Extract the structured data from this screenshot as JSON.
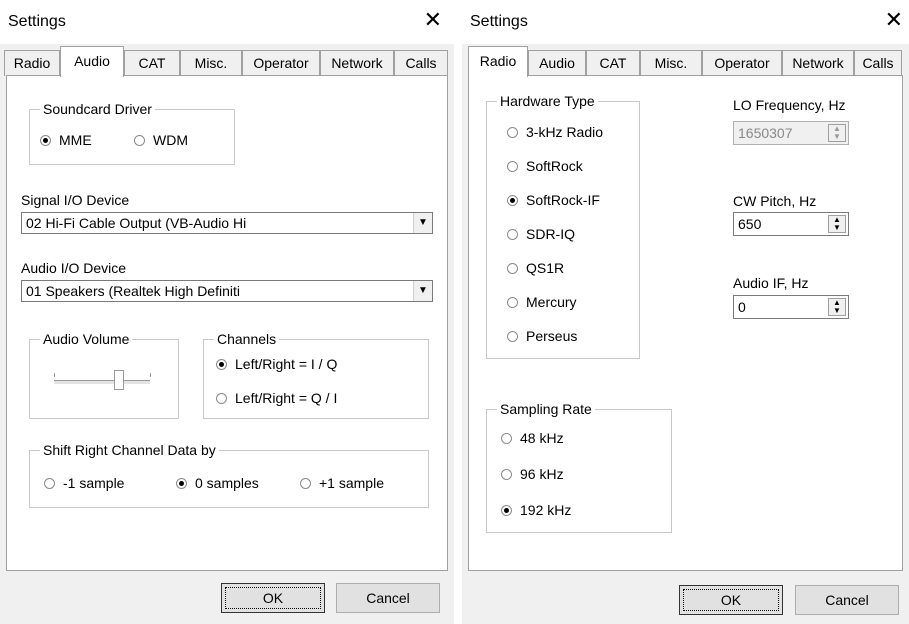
{
  "left": {
    "title": "Settings",
    "close": "✕",
    "tabs": [
      "Radio",
      "Audio",
      "CAT",
      "Misc.",
      "Operator",
      "Network",
      "Calls"
    ],
    "active_tab": "Audio",
    "soundcard_driver": {
      "legend": "Soundcard Driver",
      "options": [
        "MME",
        "WDM"
      ],
      "selected": "MME"
    },
    "signal_io": {
      "label": "Signal I/O Device",
      "value": "02  Hi-Fi Cable Output (VB-Audio Hi"
    },
    "audio_io": {
      "label": "Audio I/O Device",
      "value": "01  Speakers (Realtek High Definiti"
    },
    "audio_volume": {
      "legend": "Audio Volume",
      "level": 0.7
    },
    "channels": {
      "legend": "Channels",
      "options": [
        "Left/Right = I / Q",
        "Left/Right = Q / I"
      ],
      "selected": "Left/Right = I / Q"
    },
    "shift": {
      "legend": "Shift Right Channel Data by",
      "options": [
        "-1 sample",
        "0 samples",
        "+1 sample"
      ],
      "selected": "0 samples"
    },
    "ok": "OK",
    "cancel": "Cancel"
  },
  "right": {
    "title": "Settings",
    "close": "✕",
    "tabs": [
      "Radio",
      "Audio",
      "CAT",
      "Misc.",
      "Operator",
      "Network",
      "Calls"
    ],
    "active_tab": "Radio",
    "hardware_type": {
      "legend": "Hardware Type",
      "options": [
        "3-kHz Radio",
        "SoftRock",
        "SoftRock-IF",
        "SDR-IQ",
        "QS1R",
        "Mercury",
        "Perseus"
      ],
      "selected": "SoftRock-IF"
    },
    "lo_frequency": {
      "label": "LO Frequency, Hz",
      "value": "1650307",
      "disabled": true
    },
    "cw_pitch": {
      "label": "CW Pitch, Hz",
      "value": "650"
    },
    "audio_if": {
      "label": "Audio IF, Hz",
      "value": "0"
    },
    "sampling_rate": {
      "legend": "Sampling Rate",
      "options": [
        "48 kHz",
        "96 kHz",
        "192 kHz"
      ],
      "selected": "192 kHz"
    },
    "ok": "OK",
    "cancel": "Cancel"
  }
}
